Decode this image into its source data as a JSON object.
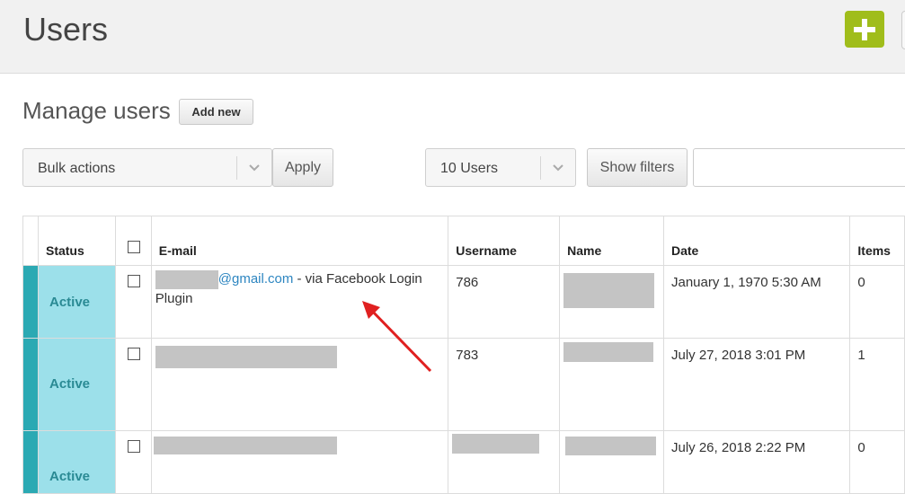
{
  "header": {
    "title": "Users"
  },
  "section": {
    "title": "Manage users",
    "add_new_label": "Add new"
  },
  "toolbar": {
    "bulk_actions": "Bulk actions",
    "apply_label": "Apply",
    "per_page": "10 Users",
    "show_filters_label": "Show filters",
    "search_value": ""
  },
  "table": {
    "columns": {
      "status": "Status",
      "email": "E-mail",
      "username": "Username",
      "name": "Name",
      "date": "Date",
      "items": "Items"
    },
    "rows": [
      {
        "status": "Active",
        "email_domain": "@gmail.com",
        "email_suffix": " - via Facebook Login Plugin",
        "username": "786",
        "date": "January 1, 1970 5:30 AM",
        "items": "0"
      },
      {
        "status": "Active",
        "username": "783",
        "date": "July 27, 2018 3:01 PM",
        "items": "1"
      },
      {
        "status": "Active",
        "date": "July 26, 2018 2:22 PM",
        "items": "0"
      }
    ]
  },
  "colors": {
    "accent": "#2ba9b3",
    "status_bg": "#9ce0ea",
    "add_button": "#a0bd1b",
    "annotation_arrow": "#e02020"
  },
  "icons": {
    "add": "plus-icon",
    "dropdown": "chevron-down-icon"
  }
}
